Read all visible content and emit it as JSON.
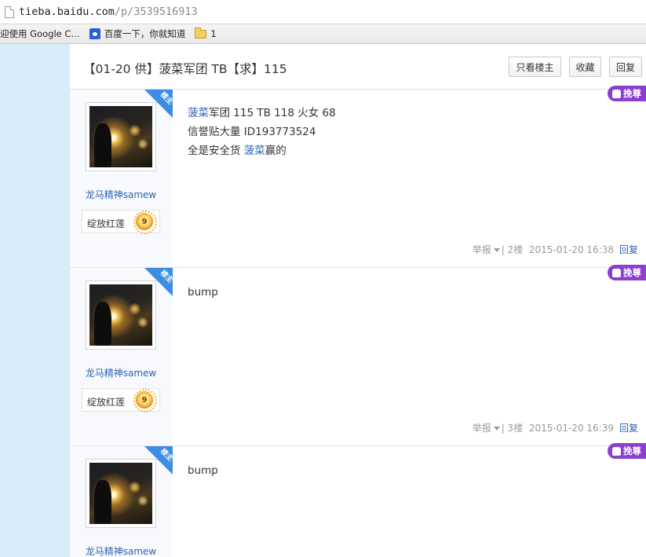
{
  "browser": {
    "url_host": "tieba.baidu.com",
    "url_path": "/p/3539516913",
    "bookmarks": [
      {
        "label": "迎使用 Google C…",
        "icon": "page-icon"
      },
      {
        "label": "百度一下，你就知道",
        "icon": "baidu-paw-icon"
      },
      {
        "label": "1",
        "icon": "folder-icon"
      }
    ]
  },
  "thread": {
    "title": "【01-20 供】菠菜军团 TB【求】115",
    "buttons": {
      "only_op": "只看楼主",
      "favorite": "收藏",
      "reply": "回复"
    }
  },
  "posts": [
    {
      "author": "龙马精神samew",
      "badge": "绽放红莲",
      "level": "9",
      "op_ribbon": "楼主",
      "tag": "挽尊",
      "lines": [
        {
          "kw": "菠菜",
          "rest": "军团 115 TB 118 火女 68"
        },
        {
          "kw": "",
          "rest": "信誉贴大量 ID193773524"
        },
        {
          "pre": "全是安全货 ",
          "kw": "菠菜",
          "rest": "赢的"
        }
      ],
      "report": "举报",
      "floor": "| 2楼",
      "time": "2015-01-20 16:38",
      "reply": "回复"
    },
    {
      "author": "龙马精神samew",
      "badge": "绽放红莲",
      "level": "9",
      "op_ribbon": "楼主",
      "tag": "挽尊",
      "text": "bump",
      "report": "举报",
      "floor": "| 3楼",
      "time": "2015-01-20 16:39",
      "reply": "回复"
    },
    {
      "author": "龙马精神samew",
      "op_ribbon": "楼主",
      "tag": "挽尊",
      "text": "bump"
    }
  ],
  "colors": {
    "sidebar_bg": "#d8ecfa",
    "link": "#2d64b3",
    "tag_purple": "#8a3fd1",
    "ribbon_blue": "#3e8de3"
  }
}
